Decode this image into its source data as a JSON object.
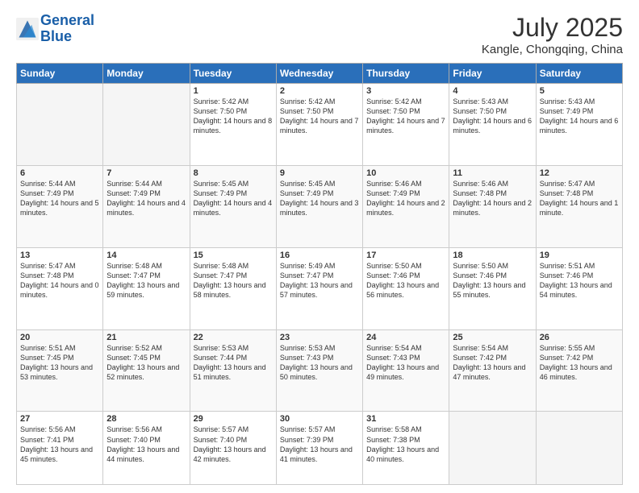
{
  "header": {
    "logo_line1": "General",
    "logo_line2": "Blue",
    "title": "July 2025",
    "subtitle": "Kangle, Chongqing, China"
  },
  "weekdays": [
    "Sunday",
    "Monday",
    "Tuesday",
    "Wednesday",
    "Thursday",
    "Friday",
    "Saturday"
  ],
  "weeks": [
    [
      {
        "day": "",
        "info": ""
      },
      {
        "day": "",
        "info": ""
      },
      {
        "day": "1",
        "info": "Sunrise: 5:42 AM\nSunset: 7:50 PM\nDaylight: 14 hours and 8 minutes."
      },
      {
        "day": "2",
        "info": "Sunrise: 5:42 AM\nSunset: 7:50 PM\nDaylight: 14 hours and 7 minutes."
      },
      {
        "day": "3",
        "info": "Sunrise: 5:42 AM\nSunset: 7:50 PM\nDaylight: 14 hours and 7 minutes."
      },
      {
        "day": "4",
        "info": "Sunrise: 5:43 AM\nSunset: 7:50 PM\nDaylight: 14 hours and 6 minutes."
      },
      {
        "day": "5",
        "info": "Sunrise: 5:43 AM\nSunset: 7:49 PM\nDaylight: 14 hours and 6 minutes."
      }
    ],
    [
      {
        "day": "6",
        "info": "Sunrise: 5:44 AM\nSunset: 7:49 PM\nDaylight: 14 hours and 5 minutes."
      },
      {
        "day": "7",
        "info": "Sunrise: 5:44 AM\nSunset: 7:49 PM\nDaylight: 14 hours and 4 minutes."
      },
      {
        "day": "8",
        "info": "Sunrise: 5:45 AM\nSunset: 7:49 PM\nDaylight: 14 hours and 4 minutes."
      },
      {
        "day": "9",
        "info": "Sunrise: 5:45 AM\nSunset: 7:49 PM\nDaylight: 14 hours and 3 minutes."
      },
      {
        "day": "10",
        "info": "Sunrise: 5:46 AM\nSunset: 7:49 PM\nDaylight: 14 hours and 2 minutes."
      },
      {
        "day": "11",
        "info": "Sunrise: 5:46 AM\nSunset: 7:48 PM\nDaylight: 14 hours and 2 minutes."
      },
      {
        "day": "12",
        "info": "Sunrise: 5:47 AM\nSunset: 7:48 PM\nDaylight: 14 hours and 1 minute."
      }
    ],
    [
      {
        "day": "13",
        "info": "Sunrise: 5:47 AM\nSunset: 7:48 PM\nDaylight: 14 hours and 0 minutes."
      },
      {
        "day": "14",
        "info": "Sunrise: 5:48 AM\nSunset: 7:47 PM\nDaylight: 13 hours and 59 minutes."
      },
      {
        "day": "15",
        "info": "Sunrise: 5:48 AM\nSunset: 7:47 PM\nDaylight: 13 hours and 58 minutes."
      },
      {
        "day": "16",
        "info": "Sunrise: 5:49 AM\nSunset: 7:47 PM\nDaylight: 13 hours and 57 minutes."
      },
      {
        "day": "17",
        "info": "Sunrise: 5:50 AM\nSunset: 7:46 PM\nDaylight: 13 hours and 56 minutes."
      },
      {
        "day": "18",
        "info": "Sunrise: 5:50 AM\nSunset: 7:46 PM\nDaylight: 13 hours and 55 minutes."
      },
      {
        "day": "19",
        "info": "Sunrise: 5:51 AM\nSunset: 7:46 PM\nDaylight: 13 hours and 54 minutes."
      }
    ],
    [
      {
        "day": "20",
        "info": "Sunrise: 5:51 AM\nSunset: 7:45 PM\nDaylight: 13 hours and 53 minutes."
      },
      {
        "day": "21",
        "info": "Sunrise: 5:52 AM\nSunset: 7:45 PM\nDaylight: 13 hours and 52 minutes."
      },
      {
        "day": "22",
        "info": "Sunrise: 5:53 AM\nSunset: 7:44 PM\nDaylight: 13 hours and 51 minutes."
      },
      {
        "day": "23",
        "info": "Sunrise: 5:53 AM\nSunset: 7:43 PM\nDaylight: 13 hours and 50 minutes."
      },
      {
        "day": "24",
        "info": "Sunrise: 5:54 AM\nSunset: 7:43 PM\nDaylight: 13 hours and 49 minutes."
      },
      {
        "day": "25",
        "info": "Sunrise: 5:54 AM\nSunset: 7:42 PM\nDaylight: 13 hours and 47 minutes."
      },
      {
        "day": "26",
        "info": "Sunrise: 5:55 AM\nSunset: 7:42 PM\nDaylight: 13 hours and 46 minutes."
      }
    ],
    [
      {
        "day": "27",
        "info": "Sunrise: 5:56 AM\nSunset: 7:41 PM\nDaylight: 13 hours and 45 minutes."
      },
      {
        "day": "28",
        "info": "Sunrise: 5:56 AM\nSunset: 7:40 PM\nDaylight: 13 hours and 44 minutes."
      },
      {
        "day": "29",
        "info": "Sunrise: 5:57 AM\nSunset: 7:40 PM\nDaylight: 13 hours and 42 minutes."
      },
      {
        "day": "30",
        "info": "Sunrise: 5:57 AM\nSunset: 7:39 PM\nDaylight: 13 hours and 41 minutes."
      },
      {
        "day": "31",
        "info": "Sunrise: 5:58 AM\nSunset: 7:38 PM\nDaylight: 13 hours and 40 minutes."
      },
      {
        "day": "",
        "info": ""
      },
      {
        "day": "",
        "info": ""
      }
    ]
  ]
}
